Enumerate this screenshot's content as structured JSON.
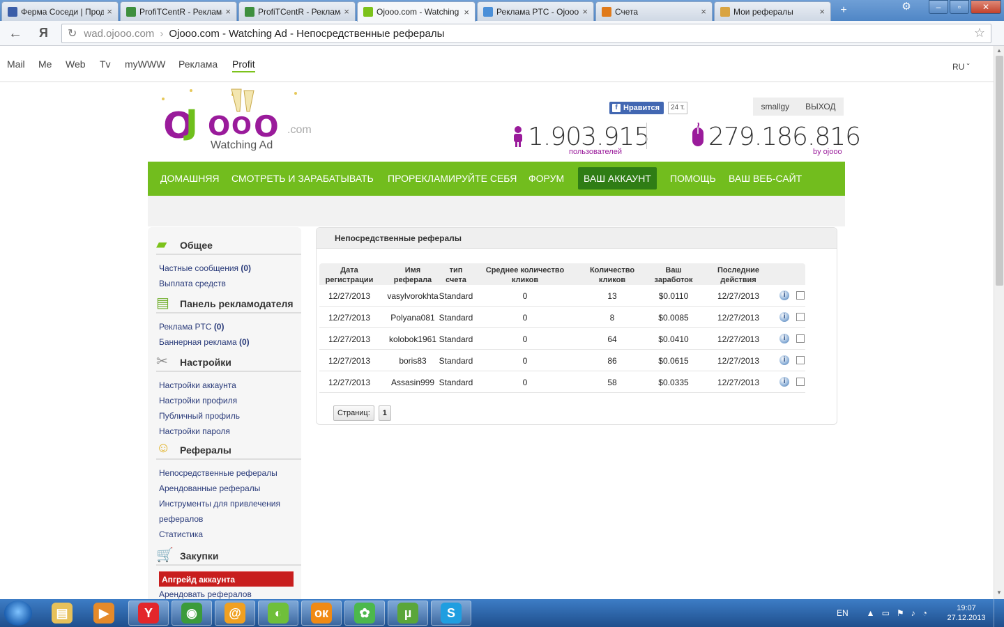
{
  "browser": {
    "tabs": [
      {
        "label": "Ферма Соседи | Прод",
        "color": "#3b5ea8",
        "active": false
      },
      {
        "label": "ProfiTCentR - Реклама",
        "color": "#3e8f3e",
        "active": false
      },
      {
        "label": "ProfiTCentR - Реклама",
        "color": "#3e8f3e",
        "active": false
      },
      {
        "label": "Ojooo.com - Watching",
        "color": "#7cc21b",
        "active": true
      },
      {
        "label": "Реклама PTC - Ojooo",
        "color": "#4a8fd8",
        "active": false
      },
      {
        "label": "Счета",
        "color": "#e07a1a",
        "active": false
      },
      {
        "label": "Мои рефералы",
        "color": "#d9a441",
        "active": false
      }
    ],
    "tab_close": "×",
    "address_domain": "wad.ojooo.com",
    "address_sep": "›",
    "address_title": "Ojooo.com - Watching Ad - Непосредственные рефералы",
    "nav_back": "←",
    "nav_ya": "Я",
    "reload": "↻",
    "star": "☆"
  },
  "topnav": {
    "items": [
      "Mail",
      "Me",
      "Web",
      "Tv",
      "myWWW",
      "Реклама",
      "Profit"
    ],
    "active_index": 6,
    "lang": "RU ˇ"
  },
  "header": {
    "logo_text": "OJOOO",
    "logo_sub": "Watching Ad",
    "logo_com": ".com",
    "fb_label": "Нравится",
    "fb_f": "f",
    "fb_count": "24 т.",
    "username": "smallgy",
    "logout": "ВЫХОД",
    "users_value": "1.903.915",
    "users_label": "пользователей",
    "clicks_value": "279.186.816",
    "clicks_label": "by ojooo"
  },
  "menu": {
    "items": [
      "ДОМАШНЯЯ",
      "СМОТРЕТЬ И ЗАРАБАТЫВАТЬ",
      "ПРОРЕКЛАМИРУЙТЕ СЕБЯ",
      "ФОРУМ",
      "ВАШ АККАУНТ",
      "ПОМОЩЬ",
      "ВАШ ВЕБ-САЙТ"
    ],
    "active_index": 4
  },
  "sidebar": {
    "sections": [
      {
        "title": "Общее",
        "links": [
          {
            "text": "Частные сообщения",
            "count": "(0)"
          },
          {
            "text": "Выплата средств"
          }
        ]
      },
      {
        "title": "Панель рекламодателя",
        "links": [
          {
            "text": "Реклама PTC",
            "count": "(0)"
          },
          {
            "text": "Баннерная реклама",
            "count": "(0)"
          }
        ]
      },
      {
        "title": "Настройки",
        "links": [
          {
            "text": "Настройки аккаунта"
          },
          {
            "text": "Настройки профиля"
          },
          {
            "text": "Публичный профиль"
          },
          {
            "text": "Настройки пароля"
          }
        ]
      },
      {
        "title": "Рефералы",
        "links": [
          {
            "text": "Непосредственные рефералы"
          },
          {
            "text": "Арендованные рефералы"
          },
          {
            "text": "Инструменты для привлечения"
          },
          {
            "text": "рефералов"
          },
          {
            "text": "Статистика"
          }
        ]
      },
      {
        "title": "Закупки",
        "links": [
          {
            "text": "Апгрейд аккаунта",
            "highlight": true
          },
          {
            "text": "Арендовать рефералов"
          }
        ]
      }
    ]
  },
  "panel": {
    "title": "Непосредственные рефералы",
    "columns": [
      {
        "line1": "Дата",
        "line2": "регистрации"
      },
      {
        "line1": "Имя",
        "line2": "реферала"
      },
      {
        "line1": "тип",
        "line2": "счета"
      },
      {
        "line1": "Среднее количество",
        "line2": "кликов"
      },
      {
        "line1": "Количество",
        "line2": "кликов"
      },
      {
        "line1": "Ваш",
        "line2": "заработок"
      },
      {
        "line1": "Последние",
        "line2": "действия"
      }
    ],
    "rows": [
      {
        "date": "12/27/2013",
        "name": "vasylvorokhta",
        "type": "Standard",
        "avg": "0",
        "clicks": "13",
        "earn": "$0.0110",
        "last": "12/27/2013"
      },
      {
        "date": "12/27/2013",
        "name": "Polyana081",
        "type": "Standard",
        "avg": "0",
        "clicks": "8",
        "earn": "$0.0085",
        "last": "12/27/2013"
      },
      {
        "date": "12/27/2013",
        "name": "kolobok1961",
        "type": "Standard",
        "avg": "0",
        "clicks": "64",
        "earn": "$0.0410",
        "last": "12/27/2013"
      },
      {
        "date": "12/27/2013",
        "name": "boris83",
        "type": "Standard",
        "avg": "0",
        "clicks": "86",
        "earn": "$0.0615",
        "last": "12/27/2013"
      },
      {
        "date": "12/27/2013",
        "name": "Assasin999",
        "type": "Standard",
        "avg": "0",
        "clicks": "58",
        "earn": "$0.0335",
        "last": "12/27/2013"
      }
    ],
    "info_glyph": "i",
    "pages_label": "Страниц:",
    "page_current": "1"
  },
  "taskbar": {
    "apps": [
      {
        "name": "explorer",
        "glyph": "▤",
        "color": "#e7c15a",
        "running": false
      },
      {
        "name": "media-player",
        "glyph": "▶",
        "color": "#e58a2a",
        "running": false
      },
      {
        "name": "yandex-browser",
        "glyph": "Y",
        "color": "#e3262b",
        "running": true
      },
      {
        "name": "chrome",
        "glyph": "◉",
        "color": "#3b9b3b",
        "running": true
      },
      {
        "name": "mail-agent",
        "glyph": "@",
        "color": "#f0a020",
        "running": true
      },
      {
        "name": "game",
        "glyph": "◐",
        "color": "#6fbf3a",
        "running": true
      },
      {
        "name": "odnoklassniki",
        "glyph": "ок",
        "color": "#f08a14",
        "running": true
      },
      {
        "name": "icq",
        "glyph": "✿",
        "color": "#4cb84c",
        "running": true
      },
      {
        "name": "utorrent",
        "glyph": "µ",
        "color": "#5aa63a",
        "running": true
      },
      {
        "name": "skype",
        "glyph": "S",
        "color": "#1f9ee0",
        "running": true
      }
    ],
    "lang": "EN",
    "time": "19:07",
    "date": "27.12.2013"
  }
}
